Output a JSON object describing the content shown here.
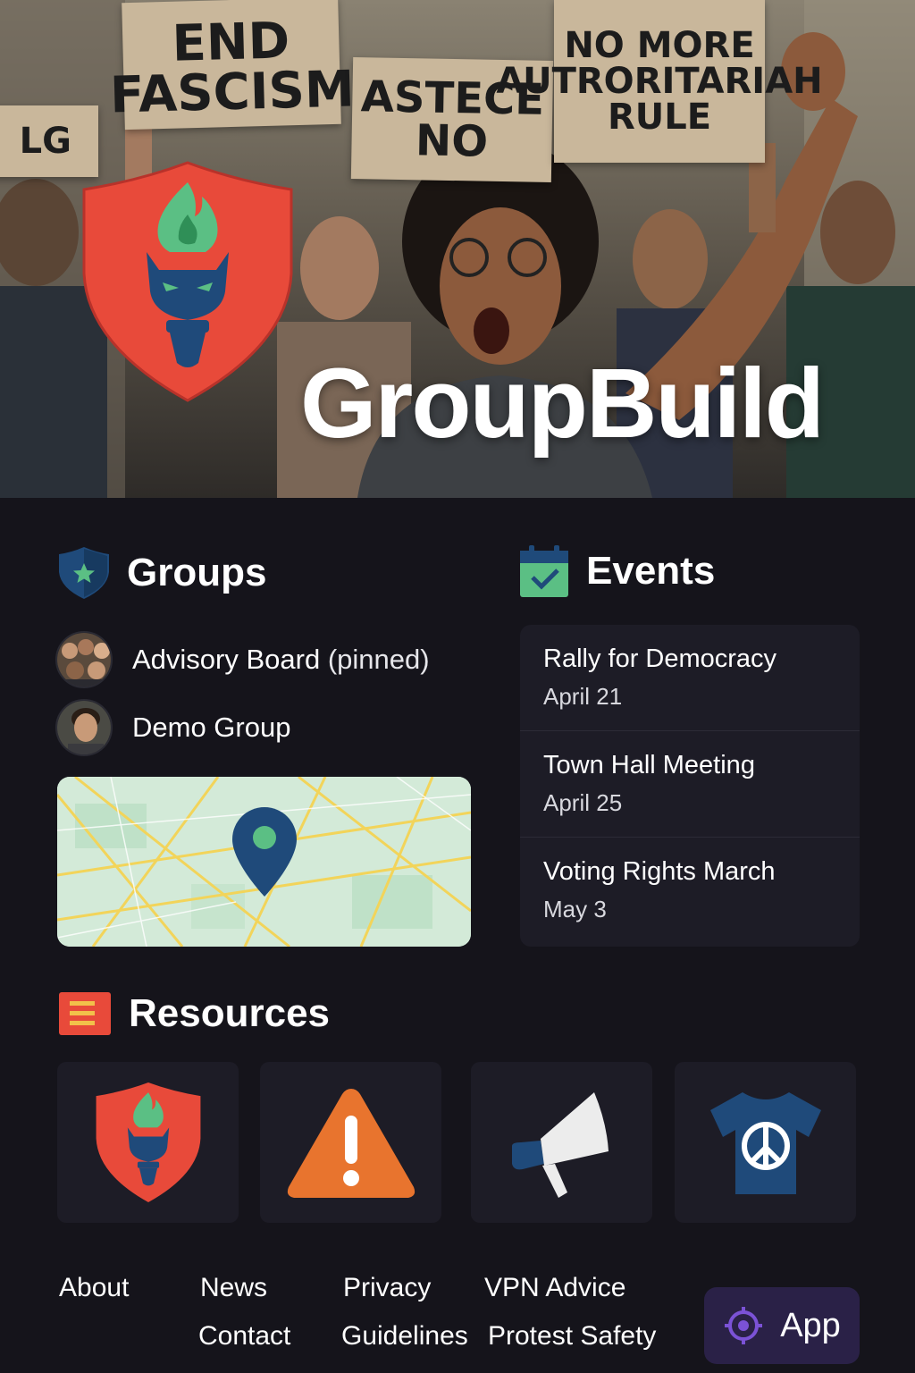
{
  "hero": {
    "title": "GroupBuild",
    "signs": [
      "END FASCISM",
      "ASTECE NO",
      "NO MORE AUTRORITARIAH RULE",
      "LG"
    ]
  },
  "groups": {
    "title": "Groups",
    "items": [
      {
        "name": "Advisory Board",
        "tag": "(pinned)"
      },
      {
        "name": "Demo Group",
        "tag": ""
      }
    ]
  },
  "events": {
    "title": "Events",
    "items": [
      {
        "title": "Rally for Democracy",
        "date": "April 21"
      },
      {
        "title": "Town Hall Meeting",
        "date": "April 25"
      },
      {
        "title": "Voting Rights March",
        "date": "May 3"
      }
    ]
  },
  "resources": {
    "title": "Resources",
    "items": [
      {
        "icon": "shield-logo-icon"
      },
      {
        "icon": "warning-icon"
      },
      {
        "icon": "megaphone-icon"
      },
      {
        "icon": "peace-shirt-icon"
      }
    ]
  },
  "footer": {
    "links": [
      "About",
      "News",
      "Contact",
      "Privacy",
      "Guidelines",
      "VPN Advice",
      "Protest Safety"
    ],
    "app_label": "App"
  },
  "colors": {
    "background": "#15141b",
    "card": "#1d1c26",
    "brand_red": "#e84a3a",
    "brand_navy": "#1f4a7a",
    "brand_green": "#5bbf84",
    "accent_purple": "#7b52d6",
    "warning_orange": "#e8742e"
  }
}
